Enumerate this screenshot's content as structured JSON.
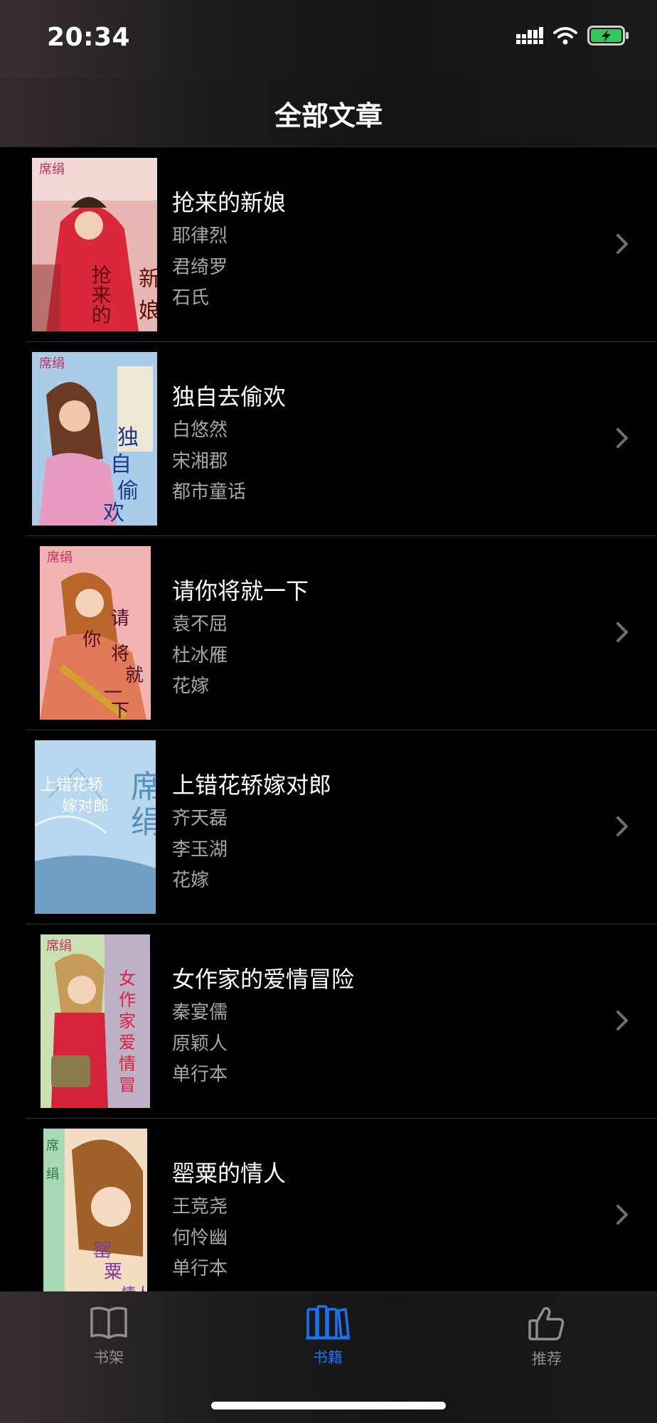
{
  "status": {
    "time": "20:34",
    "icons": [
      "cellular-signal-icon",
      "wifi-icon",
      "battery-charging-icon"
    ]
  },
  "nav": {
    "title": "全部文章"
  },
  "books": [
    {
      "title": "抢来的新娘",
      "author": "耶律烈",
      "heroine": "君绮罗",
      "series": "石氏",
      "cover_text": "抢来的新娘",
      "cover_color": "#d83040"
    },
    {
      "title": "独自去偷欢",
      "author": "白悠然",
      "heroine": "宋湘郡",
      "series": "都市童话",
      "cover_text": "独自去偷欢",
      "cover_color": "#9fc6e0"
    },
    {
      "title": "请你将就一下",
      "author": "袁不屈",
      "heroine": "杜冰雁",
      "series": "花嫁",
      "cover_text": "请你将就一下",
      "cover_color": "#e58a8a"
    },
    {
      "title": "上错花轿嫁对郎",
      "author": "齐天磊",
      "heroine": "李玉湖",
      "series": "花嫁",
      "cover_text": "上错花轿嫁对郎",
      "cover_color": "#9dc9e6"
    },
    {
      "title": "女作家的爱情冒险",
      "author": "秦宴儒",
      "heroine": "原颖人",
      "series": "单行本",
      "cover_text": "女作家的爱情冒险",
      "cover_color": "#b9d9a4"
    },
    {
      "title": "罂粟的情人",
      "author": "王竞尧",
      "heroine": "何怜幽",
      "series": "单行本",
      "cover_text": "罂粟的情人",
      "cover_color": "#f1d2b0"
    }
  ],
  "tabs": [
    {
      "label": "书架",
      "icon": "open-book-icon",
      "active": false
    },
    {
      "label": "书籍",
      "icon": "books-icon",
      "active": true
    },
    {
      "label": "推荐",
      "icon": "thumbs-up-icon",
      "active": false
    }
  ],
  "colors": {
    "accent": "#1a73f0",
    "inactive": "#8e8e93",
    "subtitle": "#a6a6a6"
  }
}
